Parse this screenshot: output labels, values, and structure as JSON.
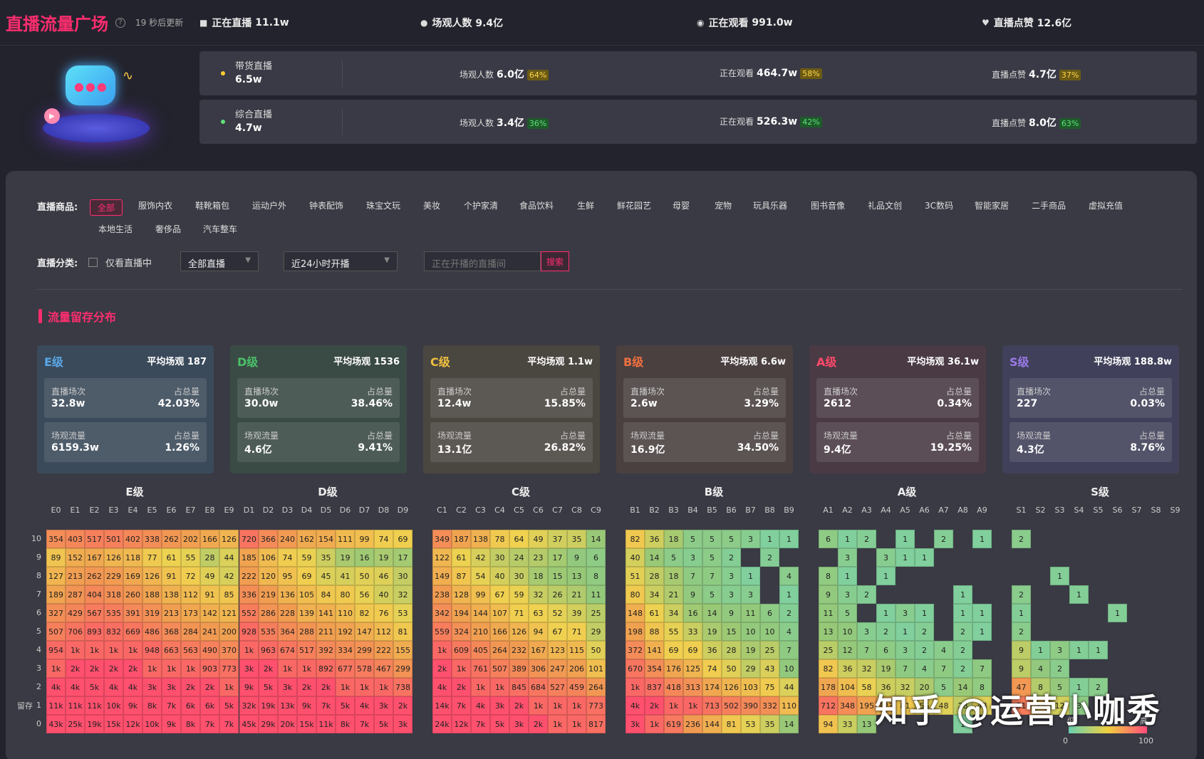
{
  "header": {
    "brand": "直播流量广场",
    "update_note": "19 秒后更新",
    "stats": [
      {
        "icon": "camera-icon",
        "label": "正在直播",
        "value": "11.1w"
      },
      {
        "icon": "users-icon",
        "label": "场观人数",
        "value": "9.4亿"
      },
      {
        "icon": "eye-icon",
        "label": "正在观看",
        "value": "991.0w"
      },
      {
        "icon": "heart-icon",
        "label": "直播点赞",
        "value": "12.6亿"
      }
    ]
  },
  "live_types": [
    {
      "name": "带货直播",
      "value": "6.5w",
      "dot": "#ffcc33",
      "metrics": [
        {
          "label": "场观人数",
          "value": "6.0亿",
          "pct": "64%",
          "tone": "y"
        },
        {
          "label": "正在观看",
          "value": "464.7w",
          "pct": "58%",
          "tone": "y"
        },
        {
          "label": "直播点赞",
          "value": "4.7亿",
          "pct": "37%",
          "tone": "y"
        }
      ]
    },
    {
      "name": "综合直播",
      "value": "4.7w",
      "dot": "#5fe07a",
      "metrics": [
        {
          "label": "场观人数",
          "value": "3.4亿",
          "pct": "36%",
          "tone": "g"
        },
        {
          "label": "正在观看",
          "value": "526.3w",
          "pct": "42%",
          "tone": "g"
        },
        {
          "label": "直播点赞",
          "value": "8.0亿",
          "pct": "63%",
          "tone": "g"
        }
      ]
    }
  ],
  "filters": {
    "goods_label": "直播商品:",
    "categories": [
      "全部",
      "服饰内衣",
      "鞋靴箱包",
      "运动户外",
      "钟表配饰",
      "珠宝文玩",
      "美妆",
      "个护家清",
      "食品饮料",
      "生鲜",
      "鲜花园艺",
      "母婴",
      "宠物",
      "玩具乐器",
      "图书音像",
      "礼品文创",
      "3C数码",
      "智能家居",
      "二手商品",
      "虚拟充值",
      "本地生活",
      "奢侈品",
      "汽车整车"
    ],
    "class_label": "直播分类:",
    "only_live": "仅看直播中",
    "live_select": "全部直播",
    "time_select": "近24小时开播",
    "search_placeholder": "正在开播的直播间",
    "search_btn": "搜索"
  },
  "section_title": "流量留存分布",
  "colors": {
    "accent": "#ff2d6f"
  },
  "levels": [
    {
      "level": "E级",
      "color": "#5aa8e8",
      "bg": "#3a4a5a",
      "avg": "平均场观 187",
      "sessions": "32.8w",
      "sessions_pct": "42.03%",
      "traffic": "6159.3w",
      "traffic_pct": "1.26%"
    },
    {
      "level": "D级",
      "color": "#4ac06a",
      "bg": "#3a4a44",
      "avg": "平均场观 1536",
      "sessions": "30.0w",
      "sessions_pct": "38.46%",
      "traffic": "4.6亿",
      "traffic_pct": "9.41%"
    },
    {
      "level": "C级",
      "color": "#f0c040",
      "bg": "#4a4640",
      "avg": "平均场观 1.1w",
      "sessions": "12.4w",
      "sessions_pct": "15.85%",
      "traffic": "13.1亿",
      "traffic_pct": "26.82%"
    },
    {
      "level": "B级",
      "color": "#f07040",
      "bg": "#4a4040",
      "avg": "平均场观 6.6w",
      "sessions": "2.6w",
      "sessions_pct": "3.29%",
      "traffic": "16.9亿",
      "traffic_pct": "34.50%"
    },
    {
      "level": "A级",
      "color": "#ff4a6a",
      "bg": "#4a3a44",
      "avg": "平均场观 36.1w",
      "sessions": "2612",
      "sessions_pct": "0.34%",
      "traffic": "9.4亿",
      "traffic_pct": "19.25%"
    },
    {
      "level": "S级",
      "color": "#9a7ae8",
      "bg": "#40405a",
      "avg": "平均场观 188.8w",
      "sessions": "227",
      "sessions_pct": "0.03%",
      "traffic": "4.3亿",
      "traffic_pct": "8.76%"
    }
  ],
  "card_labels": {
    "sessions": "直播场次",
    "traffic": "场观流量",
    "share": "占总量"
  },
  "row_labels": [
    "10",
    "9",
    "8",
    "7",
    "6",
    "5",
    "4",
    "3",
    "2",
    "1",
    "0"
  ],
  "retain_label": "留存",
  "heatmaps": [
    {
      "title": "E级",
      "cols": [
        "E0",
        "E1",
        "E2",
        "E3",
        "E4",
        "E5",
        "E6",
        "E7",
        "E8",
        "E9"
      ],
      "rows": [
        [
          "354",
          "403",
          "517",
          "501",
          "402",
          "338",
          "262",
          "202",
          "166",
          "126"
        ],
        [
          "89",
          "152",
          "167",
          "126",
          "118",
          "77",
          "61",
          "55",
          "28",
          "44"
        ],
        [
          "127",
          "213",
          "262",
          "229",
          "169",
          "126",
          "91",
          "72",
          "49",
          "42"
        ],
        [
          "189",
          "287",
          "404",
          "318",
          "260",
          "188",
          "138",
          "112",
          "91",
          "85"
        ],
        [
          "327",
          "429",
          "567",
          "535",
          "391",
          "319",
          "213",
          "173",
          "142",
          "121"
        ],
        [
          "507",
          "706",
          "893",
          "832",
          "669",
          "486",
          "368",
          "284",
          "241",
          "200"
        ],
        [
          "954",
          "1k",
          "1k",
          "1k",
          "1k",
          "948",
          "663",
          "563",
          "490",
          "370"
        ],
        [
          "1k",
          "2k",
          "2k",
          "2k",
          "2k",
          "1k",
          "1k",
          "1k",
          "903",
          "773"
        ],
        [
          "4k",
          "4k",
          "5k",
          "4k",
          "4k",
          "3k",
          "3k",
          "2k",
          "2k",
          "1k"
        ],
        [
          "11k",
          "11k",
          "11k",
          "10k",
          "9k",
          "8k",
          "7k",
          "6k",
          "6k",
          "5k"
        ],
        [
          "43k",
          "25k",
          "19k",
          "15k",
          "12k",
          "10k",
          "9k",
          "8k",
          "7k",
          "7k"
        ]
      ]
    },
    {
      "title": "D级",
      "cols": [
        "D1",
        "D2",
        "D3",
        "D4",
        "D5",
        "D6",
        "D7",
        "D8",
        "D9"
      ],
      "rows": [
        [
          "720",
          "366",
          "240",
          "162",
          "154",
          "111",
          "99",
          "74",
          "69"
        ],
        [
          "185",
          "106",
          "74",
          "59",
          "35",
          "19",
          "16",
          "19",
          "17"
        ],
        [
          "222",
          "120",
          "95",
          "69",
          "45",
          "41",
          "50",
          "46",
          "30"
        ],
        [
          "336",
          "219",
          "136",
          "105",
          "84",
          "80",
          "56",
          "40",
          "32"
        ],
        [
          "552",
          "286",
          "228",
          "139",
          "141",
          "110",
          "82",
          "76",
          "53"
        ],
        [
          "928",
          "535",
          "364",
          "288",
          "211",
          "192",
          "147",
          "112",
          "81"
        ],
        [
          "1k",
          "963",
          "674",
          "517",
          "392",
          "334",
          "299",
          "222",
          "155"
        ],
        [
          "3k",
          "2k",
          "1k",
          "1k",
          "892",
          "677",
          "578",
          "467",
          "299"
        ],
        [
          "9k",
          "5k",
          "3k",
          "2k",
          "2k",
          "1k",
          "1k",
          "1k",
          "738"
        ],
        [
          "32k",
          "19k",
          "13k",
          "9k",
          "7k",
          "5k",
          "4k",
          "3k",
          "2k"
        ],
        [
          "45k",
          "29k",
          "20k",
          "15k",
          "11k",
          "8k",
          "7k",
          "5k",
          "3k"
        ]
      ]
    },
    {
      "title": "C级",
      "cols": [
        "C1",
        "C2",
        "C3",
        "C4",
        "C5",
        "C6",
        "C7",
        "C8",
        "C9"
      ],
      "rows": [
        [
          "349",
          "187",
          "138",
          "78",
          "64",
          "49",
          "37",
          "35",
          "14"
        ],
        [
          "122",
          "61",
          "42",
          "30",
          "24",
          "23",
          "17",
          "9",
          "6"
        ],
        [
          "149",
          "87",
          "54",
          "40",
          "30",
          "18",
          "15",
          "13",
          "8"
        ],
        [
          "238",
          "128",
          "99",
          "67",
          "59",
          "32",
          "26",
          "21",
          "11"
        ],
        [
          "342",
          "194",
          "144",
          "107",
          "71",
          "63",
          "52",
          "39",
          "25"
        ],
        [
          "559",
          "324",
          "210",
          "166",
          "126",
          "94",
          "67",
          "71",
          "29"
        ],
        [
          "1k",
          "609",
          "405",
          "264",
          "232",
          "167",
          "123",
          "115",
          "50"
        ],
        [
          "2k",
          "1k",
          "761",
          "507",
          "389",
          "306",
          "247",
          "206",
          "101"
        ],
        [
          "4k",
          "2k",
          "1k",
          "1k",
          "845",
          "684",
          "527",
          "459",
          "264"
        ],
        [
          "14k",
          "7k",
          "4k",
          "3k",
          "2k",
          "1k",
          "1k",
          "1k",
          "773"
        ],
        [
          "24k",
          "12k",
          "7k",
          "5k",
          "3k",
          "2k",
          "1k",
          "1k",
          "817"
        ]
      ]
    },
    {
      "title": "B级",
      "cols": [
        "B1",
        "B2",
        "B3",
        "B4",
        "B5",
        "B6",
        "B7",
        "B8",
        "B9"
      ],
      "rows": [
        [
          "82",
          "36",
          "18",
          "5",
          "5",
          "5",
          "3",
          "1",
          "1"
        ],
        [
          "40",
          "14",
          "5",
          "3",
          "5",
          "2",
          "",
          "2",
          ""
        ],
        [
          "51",
          "28",
          "18",
          "7",
          "7",
          "3",
          "1",
          "",
          "4"
        ],
        [
          "80",
          "34",
          "21",
          "9",
          "5",
          "3",
          "3",
          "",
          "1"
        ],
        [
          "148",
          "61",
          "34",
          "16",
          "14",
          "9",
          "11",
          "6",
          "2"
        ],
        [
          "198",
          "88",
          "55",
          "33",
          "19",
          "15",
          "10",
          "10",
          "4"
        ],
        [
          "372",
          "141",
          "69",
          "69",
          "36",
          "28",
          "19",
          "25",
          "7"
        ],
        [
          "670",
          "354",
          "176",
          "125",
          "74",
          "50",
          "29",
          "43",
          "10"
        ],
        [
          "1k",
          "837",
          "418",
          "313",
          "174",
          "126",
          "103",
          "75",
          "44"
        ],
        [
          "4k",
          "2k",
          "1k",
          "1k",
          "713",
          "502",
          "390",
          "332",
          "110"
        ],
        [
          "3k",
          "1k",
          "619",
          "236",
          "144",
          "81",
          "53",
          "35",
          "14"
        ]
      ]
    },
    {
      "title": "A级",
      "cols": [
        "A1",
        "A2",
        "A3",
        "A4",
        "A5",
        "A6",
        "A7",
        "A8",
        "A9"
      ],
      "rows": [
        [
          "6",
          "1",
          "2",
          "",
          "1",
          "",
          "2",
          "",
          "1"
        ],
        [
          "",
          "3",
          "",
          "3",
          "1",
          "1",
          "",
          "",
          ""
        ],
        [
          "8",
          "1",
          "",
          "1",
          "",
          "",
          "",
          "",
          ""
        ],
        [
          "9",
          "3",
          "2",
          "",
          "",
          "",
          "",
          "1",
          ""
        ],
        [
          "11",
          "5",
          "",
          "1",
          "3",
          "1",
          "",
          "1",
          "1"
        ],
        [
          "13",
          "10",
          "3",
          "2",
          "1",
          "2",
          "",
          "2",
          "1"
        ],
        [
          "25",
          "12",
          "7",
          "6",
          "3",
          "2",
          "4",
          "2",
          ""
        ],
        [
          "82",
          "36",
          "32",
          "19",
          "7",
          "4",
          "7",
          "2",
          "7"
        ],
        [
          "178",
          "104",
          "58",
          "36",
          "32",
          "20",
          "5",
          "14",
          "8"
        ],
        [
          "712",
          "348",
          "195",
          "123",
          "81",
          "55",
          "48",
          "28",
          "48"
        ],
        [
          "94",
          "33",
          "13",
          "",
          "",
          "",
          "",
          "1",
          ""
        ]
      ]
    },
    {
      "title": "S级",
      "cols": [
        "S1",
        "S2",
        "S3",
        "S4",
        "S5",
        "S6",
        "S7",
        "S8",
        "S9"
      ],
      "rows": [
        [
          "2",
          "",
          "",
          "",
          "",
          "",
          "",
          "",
          ""
        ],
        [
          "",
          "",
          "",
          "",
          "",
          "",
          "",
          "",
          ""
        ],
        [
          "",
          "",
          "1",
          "",
          "",
          "",
          "",
          "",
          ""
        ],
        [
          "2",
          "",
          "",
          "1",
          "",
          "",
          "",
          "",
          ""
        ],
        [
          "1",
          "",
          "",
          "",
          "",
          "1",
          "",
          "",
          ""
        ],
        [
          "2",
          "",
          "",
          "",
          "",
          "",
          "",
          "",
          ""
        ],
        [
          "9",
          "1",
          "3",
          "1",
          "1",
          "",
          "",
          "",
          ""
        ],
        [
          "9",
          "4",
          "2",
          "",
          "",
          "",
          "",
          "",
          ""
        ],
        [
          "47",
          "8",
          "5",
          "1",
          "2",
          "",
          "",
          "",
          ""
        ],
        [
          "81",
          "25",
          "12",
          "3",
          "",
          "",
          "",
          "",
          ""
        ],
        [
          "",
          "",
          "",
          "",
          "",
          "",
          "",
          "",
          ""
        ]
      ]
    }
  ],
  "legend": {
    "low": "低",
    "high": "高",
    "min": "0",
    "max": "100"
  },
  "watermark": "知乎 @运营小咖秀"
}
